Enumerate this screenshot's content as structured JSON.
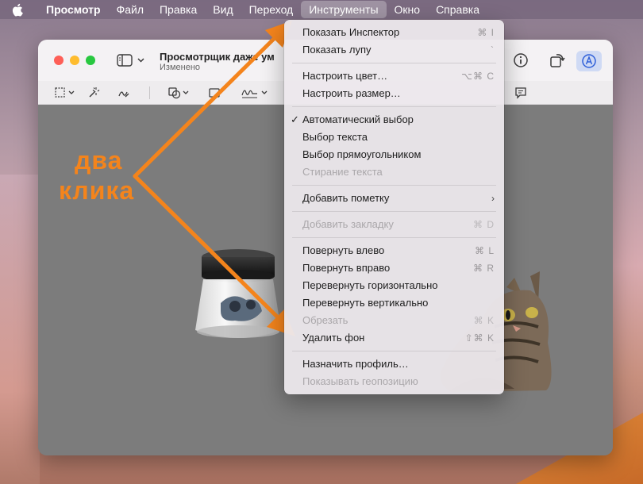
{
  "menubar": {
    "app": "Просмотр",
    "items": [
      "Файл",
      "Правка",
      "Вид",
      "Переход",
      "Инструменты",
      "Окно",
      "Справка"
    ],
    "active": "Инструменты"
  },
  "window": {
    "title": "Просмотрщик даже ум",
    "subtitle": "Изменено"
  },
  "menu": {
    "items": [
      {
        "label": "Показать Инспектор",
        "shortcut": "⌘ I",
        "enabled": true
      },
      {
        "label": "Показать лупу",
        "shortcut": "`",
        "enabled": true
      },
      {
        "label": "Настроить цвет…",
        "shortcut": "⌥⌘ C",
        "enabled": true
      },
      {
        "label": "Настроить размер…",
        "shortcut": "",
        "enabled": true
      },
      {
        "label": "Автоматический выбор",
        "shortcut": "",
        "enabled": true,
        "checked": true
      },
      {
        "label": "Выбор текста",
        "shortcut": "",
        "enabled": true
      },
      {
        "label": "Выбор прямоугольником",
        "shortcut": "",
        "enabled": true
      },
      {
        "label": "Стирание текста",
        "shortcut": "",
        "enabled": false
      },
      {
        "label": "Добавить пометку",
        "shortcut": "",
        "enabled": true,
        "submenu": true
      },
      {
        "label": "Добавить закладку",
        "shortcut": "⌘ D",
        "enabled": false
      },
      {
        "label": "Повернуть влево",
        "shortcut": "⌘ L",
        "enabled": true
      },
      {
        "label": "Повернуть вправо",
        "shortcut": "⌘ R",
        "enabled": true
      },
      {
        "label": "Перевернуть горизонтально",
        "shortcut": "",
        "enabled": true
      },
      {
        "label": "Перевернуть вертикально",
        "shortcut": "",
        "enabled": true
      },
      {
        "label": "Обрезать",
        "shortcut": "⌘ K",
        "enabled": false
      },
      {
        "label": "Удалить фон",
        "shortcut": "⇧⌘ K",
        "enabled": true
      },
      {
        "label": "Назначить профиль…",
        "shortcut": "",
        "enabled": true
      },
      {
        "label": "Показывать геопозицию",
        "shortcut": "",
        "enabled": false
      }
    ],
    "check_mark": "✓",
    "submenu_arrow": "›"
  },
  "annotation": {
    "line1": "два",
    "line2": "клика",
    "color": "#f4841c"
  },
  "icons": {
    "apple": "apple-icon",
    "sidebar": "sidebar-toggle-icon",
    "info": "info-icon",
    "rotate": "rotate-icon",
    "markup": "markup-icon"
  }
}
